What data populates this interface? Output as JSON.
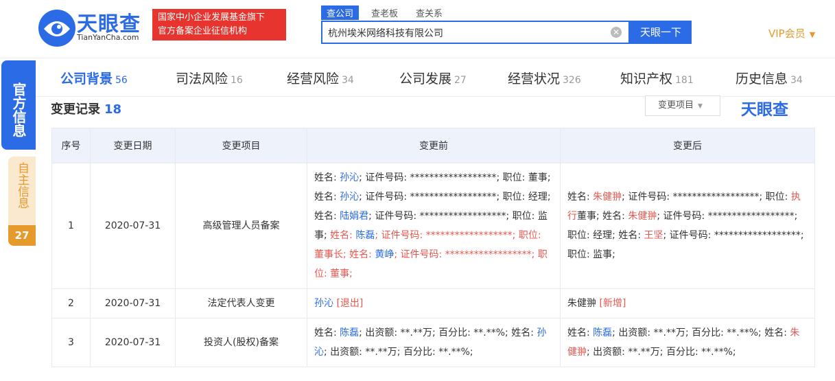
{
  "header": {
    "logo_text": "天眼查",
    "logo_sub": "TianYanCha.com",
    "badge_line1": "国家中小企业发展基金旗下",
    "badge_line2": "官方备案企业征信机构",
    "search_tabs": [
      "查公司",
      "查老板",
      "查关系"
    ],
    "search_value": "杭州埃米网络科技有限公司",
    "search_button": "天眼一下",
    "vip_label": "VIP会员"
  },
  "side": {
    "official_label": "官方信息",
    "self_label": "自主信息",
    "self_count": "27"
  },
  "nav": [
    {
      "label": "公司背景",
      "count": "56"
    },
    {
      "label": "司法风险",
      "count": "16"
    },
    {
      "label": "经营风险",
      "count": "34"
    },
    {
      "label": "公司发展",
      "count": "27"
    },
    {
      "label": "经营状况",
      "count": "326"
    },
    {
      "label": "知识产权",
      "count": "181"
    },
    {
      "label": "历史信息",
      "count": "34"
    }
  ],
  "section": {
    "title": "变更记录",
    "count": "18",
    "filter_label": "变更项目",
    "watermark": "天眼查"
  },
  "table": {
    "headers": [
      "序号",
      "变更日期",
      "变更项目",
      "变更前",
      "变更后"
    ],
    "rows": [
      {
        "index": "1",
        "date": "2020-07-31",
        "item": "高级管理人员备案",
        "before": [
          {
            "t": "姓名: "
          },
          {
            "t": "孙沁",
            "c": "blue"
          },
          {
            "t": "; 证件号码: ******************; 职位: 董事; 姓名: "
          },
          {
            "t": "孙沁",
            "c": "blue"
          },
          {
            "t": "; 证件号码: ******************; 职位: 经理; 姓名: "
          },
          {
            "t": "陆娟君",
            "c": "blue"
          },
          {
            "t": "; 证件号码: ******************; 职位: 监事; "
          },
          {
            "t": "姓名: ",
            "c": "red"
          },
          {
            "t": "陈磊",
            "c": "blue"
          },
          {
            "t": "; 证件号码: ******************; 职位: 董事长; 姓名: ",
            "c": "red"
          },
          {
            "t": "黄峥",
            "c": "blue"
          },
          {
            "t": "; 证件号码: ******************; 职位: 董事;",
            "c": "red"
          }
        ],
        "after": [
          {
            "t": "姓名: "
          },
          {
            "t": "朱健翀",
            "c": "red"
          },
          {
            "t": "; 证件号码: ******************; 职位: "
          },
          {
            "t": "执行",
            "c": "red"
          },
          {
            "t": "董事; 姓名: "
          },
          {
            "t": "朱健翀",
            "c": "red"
          },
          {
            "t": "; 证件号码: ******************; 职位: 经理; 姓名: "
          },
          {
            "t": "王坚",
            "c": "red"
          },
          {
            "t": "; 证件号码: ******************; 职位: 监事;"
          }
        ]
      },
      {
        "index": "2",
        "date": "2020-07-31",
        "item": "法定代表人变更",
        "before": [
          {
            "t": "孙沁",
            "c": "blue"
          },
          {
            "t": " [退出]",
            "c": "red"
          }
        ],
        "after": [
          {
            "t": "朱健翀"
          },
          {
            "t": " [新增]",
            "c": "red"
          }
        ]
      },
      {
        "index": "3",
        "date": "2020-07-31",
        "item": "投资人(股权)备案",
        "before": [
          {
            "t": "姓名: "
          },
          {
            "t": "陈磊",
            "c": "blue"
          },
          {
            "t": "; 出资额: **.**万; 百分比: **.**%; 姓名: "
          },
          {
            "t": "孙沁",
            "c": "blue"
          },
          {
            "t": "; 出资额: **.**万; 百分比: **.**%;"
          }
        ],
        "after": [
          {
            "t": "姓名: "
          },
          {
            "t": "陈磊",
            "c": "blue"
          },
          {
            "t": "; 出资额: **.**万; 百分比: **.**%; 姓名: "
          },
          {
            "t": "朱健翀",
            "c": "red"
          },
          {
            "t": "; 出资额: **.**万; 百分比: **.**%;"
          }
        ]
      }
    ]
  }
}
